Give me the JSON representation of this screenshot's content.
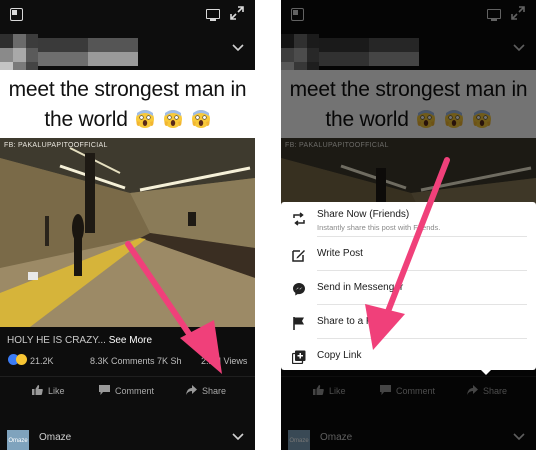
{
  "post": {
    "caption_line1": "meet the strongest man in",
    "caption_line2": "the world",
    "video_watermark": "FB: PAKALUPAPITOOFFICIAL",
    "description": "HOLY HE IS CRAZY...",
    "see_more": "See More",
    "reactions_count": "21.2K",
    "comments_count": "8.3K Comments",
    "shares_count": "7K Sh",
    "views_count": "2.1M Views"
  },
  "actions": {
    "like": "Like",
    "comment": "Comment",
    "share": "Share"
  },
  "next_post": {
    "name": "Omaze",
    "logo_text": "Omaze"
  },
  "share_menu": {
    "share_now": "Share Now (Friends)",
    "share_now_sub": "Instantly share this post with Friends.",
    "write_post": "Write Post",
    "send_messenger": "Send in Messenger",
    "share_page": "Share to a Page",
    "copy_link": "Copy Link"
  },
  "colors": {
    "arrow": "#f0407a",
    "background": "#0d0d0d",
    "facebook_blue": "#3b7cf5"
  },
  "icons": [
    "picture-in-picture-icon",
    "tv-icon",
    "expand-icon",
    "chevron-down-icon",
    "scream-emoji-icon",
    "like-icon",
    "comment-icon",
    "share-icon",
    "share-now-icon",
    "write-post-icon",
    "messenger-icon",
    "flag-icon",
    "copy-link-icon"
  ]
}
